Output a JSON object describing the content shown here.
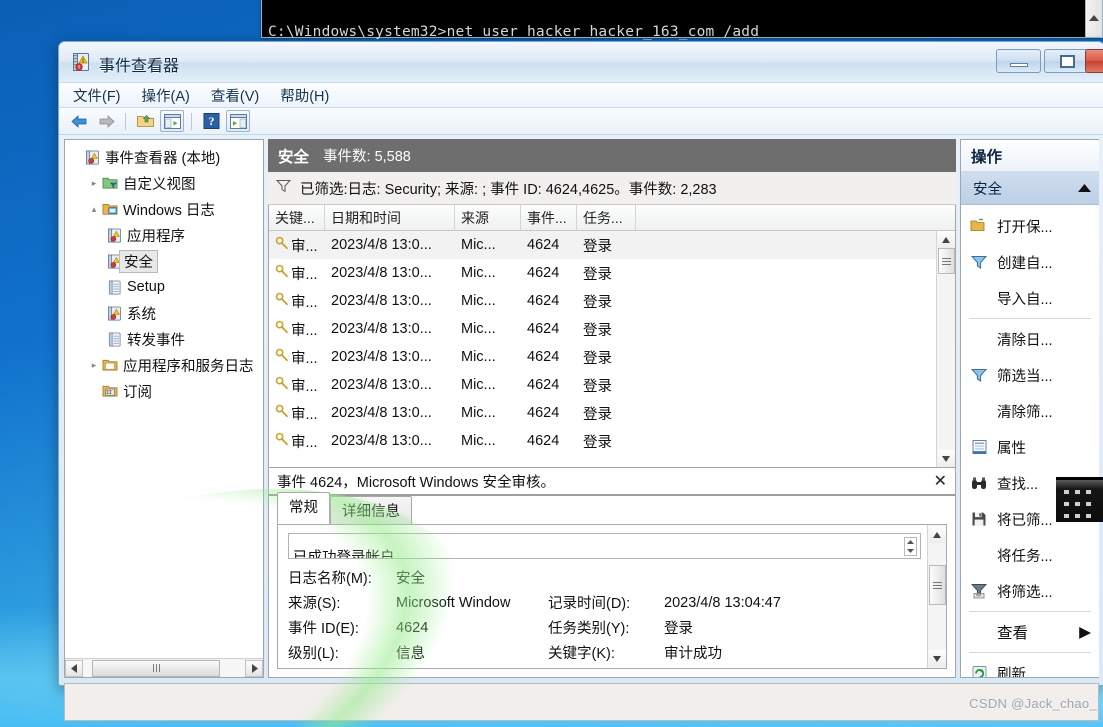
{
  "desktop": {
    "watermark": "CSDN @Jack_chao_"
  },
  "cmd_window": {
    "text": "C:\\Windows\\system32>net user hacker hacker_163_com /add",
    "scroll_icon": "scroll-up-arrow"
  },
  "window": {
    "title": "事件查看器",
    "icon": "event-viewer-icon",
    "buttons": {
      "minimize": "minimize",
      "maximize": "maximize",
      "close": "close"
    }
  },
  "menubar": {
    "items": [
      {
        "label": "文件(F)"
      },
      {
        "label": "操作(A)"
      },
      {
        "label": "查看(V)"
      },
      {
        "label": "帮助(H)"
      }
    ]
  },
  "toolbar": {
    "items": [
      {
        "icon": "back-arrow-icon",
        "enabled": true
      },
      {
        "icon": "forward-arrow-icon",
        "enabled": false
      },
      {
        "icon": "up-folder-icon",
        "enabled": true
      },
      {
        "icon": "show-console-tree-icon",
        "enabled": true
      },
      {
        "icon": "help-icon",
        "enabled": true
      },
      {
        "icon": "show-action-pane-icon",
        "enabled": true
      }
    ]
  },
  "tree": {
    "nodes": [
      {
        "label": "事件查看器 (本地)",
        "level": 1,
        "icon": "event-viewer-icon",
        "expander": "",
        "selected": false
      },
      {
        "label": "自定义视图",
        "level": 2,
        "icon": "custom-view-folder-icon",
        "expander": "▸",
        "selected": false
      },
      {
        "label": "Windows 日志",
        "level": 2,
        "icon": "windows-logs-icon",
        "expander": "▴",
        "selected": false
      },
      {
        "label": "应用程序",
        "level": 3,
        "icon": "log-icon",
        "expander": "",
        "selected": false
      },
      {
        "label": "安全",
        "level": 3,
        "icon": "log-icon",
        "expander": "",
        "selected": true
      },
      {
        "label": "Setup",
        "level": 3,
        "icon": "plain-log-icon",
        "expander": "",
        "selected": false
      },
      {
        "label": "系统",
        "level": 3,
        "icon": "log-icon",
        "expander": "",
        "selected": false
      },
      {
        "label": "转发事件",
        "level": 3,
        "icon": "plain-log-icon",
        "expander": "",
        "selected": false
      },
      {
        "label": "应用程序和服务日志",
        "level": 2,
        "icon": "app-service-logs-icon",
        "expander": "▸",
        "selected": false
      },
      {
        "label": "订阅",
        "level": 2,
        "icon": "subscriptions-icon",
        "expander": "",
        "selected": false
      }
    ],
    "hscroll": {
      "left_arrow": "◀",
      "right_arrow": "▶"
    }
  },
  "log_header": {
    "title": "安全",
    "count_label": "事件数: 5,588"
  },
  "filter_bar": {
    "icon": "filter-funnel-icon",
    "text": "已筛选:日志: Security; 来源: ; 事件 ID: 4624,4625。事件数: 2,283"
  },
  "event_list": {
    "columns": [
      "关键...",
      "日期和时间",
      "来源",
      "事件...",
      "任务...",
      ""
    ],
    "rows": [
      {
        "icon": "audit-key-icon",
        "keyword": "审...",
        "datetime": "2023/4/8 13:0...",
        "source": "Mic...",
        "event_id": "4624",
        "task": "登录",
        "selected": true
      },
      {
        "icon": "audit-key-icon",
        "keyword": "审...",
        "datetime": "2023/4/8 13:0...",
        "source": "Mic...",
        "event_id": "4624",
        "task": "登录",
        "selected": false
      },
      {
        "icon": "audit-key-icon",
        "keyword": "审...",
        "datetime": "2023/4/8 13:0...",
        "source": "Mic...",
        "event_id": "4624",
        "task": "登录",
        "selected": false
      },
      {
        "icon": "audit-key-icon",
        "keyword": "审...",
        "datetime": "2023/4/8 13:0...",
        "source": "Mic...",
        "event_id": "4624",
        "task": "登录",
        "selected": false
      },
      {
        "icon": "audit-key-icon",
        "keyword": "审...",
        "datetime": "2023/4/8 13:0...",
        "source": "Mic...",
        "event_id": "4624",
        "task": "登录",
        "selected": false
      },
      {
        "icon": "audit-key-icon",
        "keyword": "审...",
        "datetime": "2023/4/8 13:0...",
        "source": "Mic...",
        "event_id": "4624",
        "task": "登录",
        "selected": false
      },
      {
        "icon": "audit-key-icon",
        "keyword": "审...",
        "datetime": "2023/4/8 13:0...",
        "source": "Mic...",
        "event_id": "4624",
        "task": "登录",
        "selected": false
      },
      {
        "icon": "audit-key-icon",
        "keyword": "审...",
        "datetime": "2023/4/8 13:0...",
        "source": "Mic...",
        "event_id": "4624",
        "task": "登录",
        "selected": false
      }
    ],
    "scrollbar": {
      "up": "▲",
      "down": "▼"
    }
  },
  "detail": {
    "title": "事件 4624，Microsoft Windows 安全审核。",
    "close_label": "✕",
    "tabs": [
      {
        "label": "常规",
        "active": true
      },
      {
        "label": "详细信息",
        "active": false
      }
    ],
    "message": "已成功登录帐户",
    "fields": [
      {
        "key": "日志名称(M):",
        "value": "安全",
        "key2": "",
        "value2": ""
      },
      {
        "key": "来源(S):",
        "value": "Microsoft Window",
        "key2": "记录时间(D):",
        "value2": "2023/4/8 13:04:47"
      },
      {
        "key": "事件 ID(E):",
        "value": "4624",
        "key2": "任务类别(Y):",
        "value2": "登录"
      },
      {
        "key": "级别(L):",
        "value": "信息",
        "key2": "关键字(K):",
        "value2": "审计成功"
      }
    ],
    "scrollbar": {
      "up": "▲",
      "down": "▼"
    }
  },
  "actions": {
    "title": "操作",
    "subtitle": "安全",
    "collapse_icon": "collapse-up-arrow-icon",
    "items": [
      {
        "label": "打开保...",
        "icon": "open-saved-log-icon",
        "sep_after": false
      },
      {
        "label": "创建自...",
        "icon": "create-custom-view-icon",
        "sep_after": false
      },
      {
        "label": "导入自...",
        "icon": "",
        "sep_after": true
      },
      {
        "label": "清除日...",
        "icon": "",
        "sep_after": false
      },
      {
        "label": "筛选当...",
        "icon": "filter-funnel-icon",
        "sep_after": false
      },
      {
        "label": "清除筛...",
        "icon": "",
        "sep_after": false
      },
      {
        "label": "属性",
        "icon": "properties-icon",
        "sep_after": false
      },
      {
        "label": "查找...",
        "icon": "find-binoculars-icon",
        "sep_after": false
      },
      {
        "label": "将已筛...",
        "icon": "save-floppy-icon",
        "sep_after": false
      },
      {
        "label": "将任务...",
        "icon": "",
        "sep_after": false
      },
      {
        "label": "将筛选...",
        "icon": "save-filter-icon",
        "sep_after": true
      },
      {
        "label": "查看",
        "icon": "",
        "sep_after": true,
        "submenu_arrow": "▶"
      },
      {
        "label": "刷新",
        "icon": "refresh-icon",
        "sep_after": false
      }
    ]
  }
}
